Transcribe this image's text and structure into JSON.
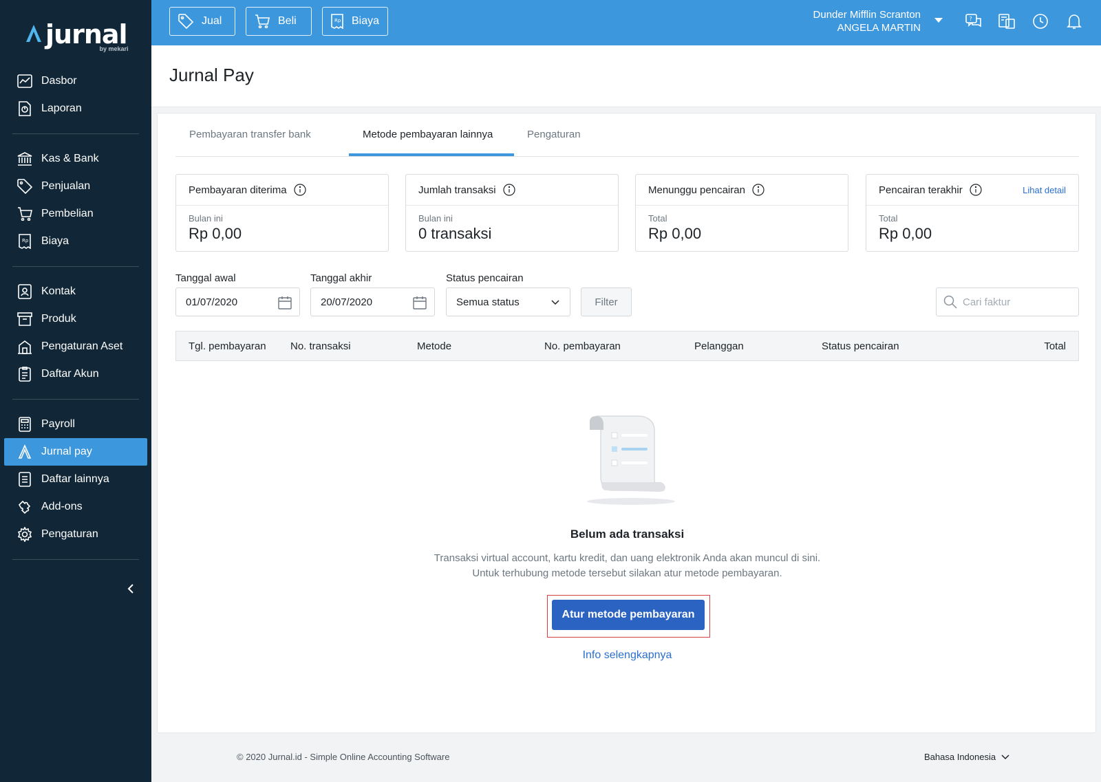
{
  "brand": {
    "name": "jurnal",
    "sub": "by mekari"
  },
  "sidebar": {
    "groups": [
      [
        {
          "label": "Dasbor",
          "icon": "dashboard-icon"
        },
        {
          "label": "Laporan",
          "icon": "report-icon"
        }
      ],
      [
        {
          "label": "Kas & Bank",
          "icon": "bank-icon"
        },
        {
          "label": "Penjualan",
          "icon": "tag-icon"
        },
        {
          "label": "Pembelian",
          "icon": "cart-icon"
        },
        {
          "label": "Biaya",
          "icon": "receipt-icon"
        }
      ],
      [
        {
          "label": "Kontak",
          "icon": "contact-icon"
        },
        {
          "label": "Produk",
          "icon": "box-icon"
        },
        {
          "label": "Pengaturan Aset",
          "icon": "asset-icon"
        },
        {
          "label": "Daftar Akun",
          "icon": "account-list-icon"
        }
      ],
      [
        {
          "label": "Payroll",
          "icon": "calculator-icon"
        },
        {
          "label": "Jurnal pay",
          "icon": "jurnal-pay-icon",
          "active": true
        },
        {
          "label": "Daftar lainnya",
          "icon": "list-icon"
        },
        {
          "label": "Add-ons",
          "icon": "puzzle-icon"
        },
        {
          "label": "Pengaturan",
          "icon": "gear-icon"
        }
      ]
    ]
  },
  "topbar": {
    "quick_buttons": [
      {
        "label": "Jual",
        "icon": "tag-icon"
      },
      {
        "label": "Beli",
        "icon": "cart-icon"
      },
      {
        "label": "Biaya",
        "icon": "receipt-icon"
      }
    ],
    "company": "Dunder Mifflin Scranton",
    "user": "ANGELA MARTIN",
    "icons": [
      "help-chat-icon",
      "switch-company-icon",
      "history-icon",
      "bell-icon"
    ]
  },
  "page": {
    "title": "Jurnal Pay"
  },
  "tabs": [
    {
      "label": "Pembayaran transfer bank",
      "active": false
    },
    {
      "label": "Metode pembayaran lainnya",
      "active": true
    },
    {
      "label": "Pengaturan",
      "active": false
    }
  ],
  "stats": [
    {
      "title": "Pembayaran diterima",
      "label": "Bulan ini",
      "value": "Rp 0,00"
    },
    {
      "title": "Jumlah transaksi",
      "label": "Bulan ini",
      "value": "0 transaksi"
    },
    {
      "title": "Menunggu pencairan",
      "label": "Total",
      "value": "Rp 0,00"
    },
    {
      "title": "Pencairan terakhir",
      "label": "Total",
      "value": "Rp 0,00",
      "link": "Lihat detail"
    }
  ],
  "filters": {
    "start_label": "Tanggal awal",
    "start_value": "01/07/2020",
    "end_label": "Tanggal akhir",
    "end_value": "20/07/2020",
    "status_label": "Status pencairan",
    "status_value": "Semua status",
    "filter_button": "Filter",
    "search_placeholder": "Cari faktur"
  },
  "table": {
    "columns": [
      "Tgl. pembayaran",
      "No. transaksi",
      "Metode",
      "No. pembayaran",
      "Pelanggan",
      "Status pencairan",
      "Total"
    ]
  },
  "empty": {
    "title": "Belum ada transaksi",
    "desc_line1": "Transaksi virtual account, kartu kredit, dan uang elektronik Anda akan muncul di sini.",
    "desc_line2": "Untuk terhubung metode tersebut silakan atur metode pembayaran.",
    "cta": "Atur metode pembayaran",
    "link": "Info selengkapnya"
  },
  "footer": {
    "copyright": "© 2020 Jurnal.id - Simple Online Accounting Software",
    "language": "Bahasa Indonesia"
  },
  "colors": {
    "sidebar": "#112737",
    "accent": "#3d97dd",
    "cta": "#2b63c2",
    "highlight": "#d9403d"
  }
}
